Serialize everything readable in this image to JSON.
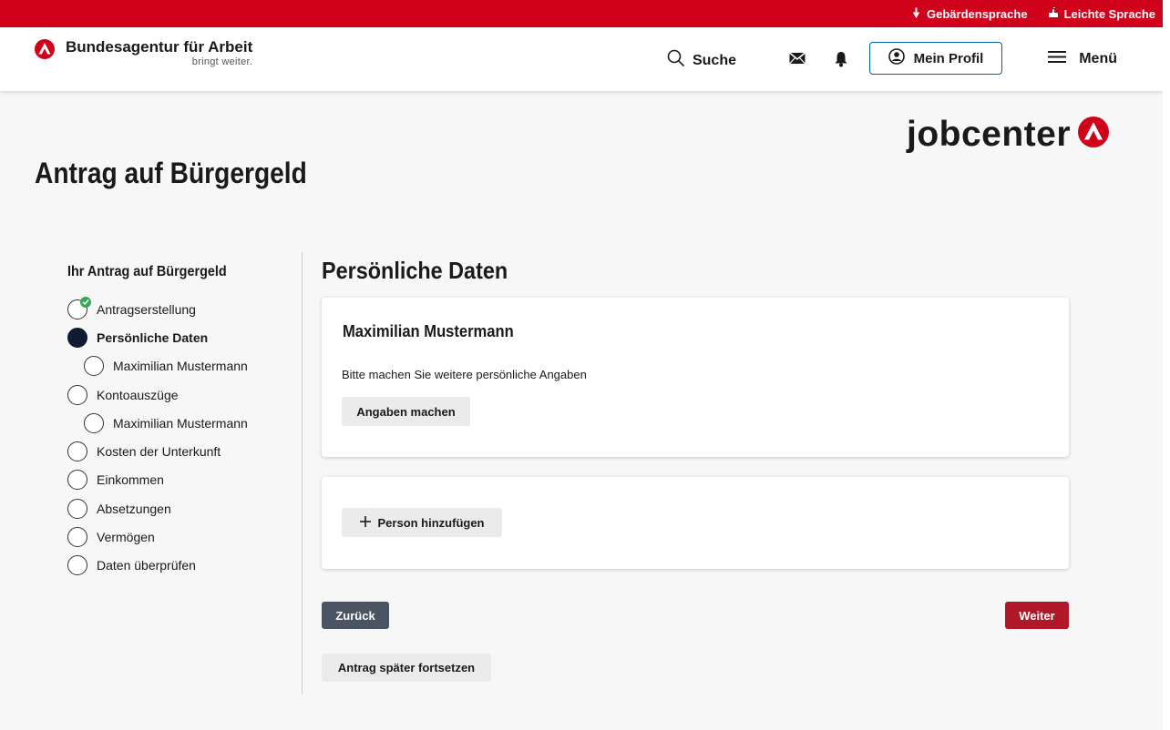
{
  "topbar": {
    "sign_language": "Gebärdensprache",
    "easy_language": "Leichte Sprache",
    "sign_icon": "hand-sign-icon",
    "easy_icon": "hand-easy-icon"
  },
  "header": {
    "brand_name": "Bundesagentur für Arbeit",
    "brand_tagline": "bringt weiter.",
    "search_label": "Suche",
    "profile_label": "Mein Profil",
    "menu_label": "Menü"
  },
  "page": {
    "title": "Antrag auf Bürgergeld",
    "jobcenter_logo": "jobcenter"
  },
  "sidebar": {
    "title": "Ihr Antrag auf Bürgergeld",
    "steps": [
      {
        "label": "Antragserstellung",
        "state": "done"
      },
      {
        "label": "Persönliche Daten",
        "state": "current"
      },
      {
        "label": "Maximilian Mustermann",
        "state": "open",
        "sub": true
      },
      {
        "label": "Kontoauszüge",
        "state": "open"
      },
      {
        "label": "Maximilian Mustermann",
        "state": "open",
        "sub": true
      },
      {
        "label": "Kosten der Unterkunft",
        "state": "open"
      },
      {
        "label": "Einkommen",
        "state": "open"
      },
      {
        "label": "Absetzungen",
        "state": "open"
      },
      {
        "label": "Vermögen",
        "state": "open"
      },
      {
        "label": "Daten überprüfen",
        "state": "open"
      }
    ]
  },
  "main": {
    "section_title": "Persönliche Daten",
    "person_card": {
      "name": "Maximilian Mustermann",
      "hint": "Bitte machen Sie weitere persönliche Angaben",
      "button": "Angaben machen"
    },
    "add_person_button": "Person hinzufügen",
    "back_button": "Zurück",
    "next_button": "Weiter",
    "later_button": "Antrag später fortsetzen"
  },
  "colors": {
    "brand_red": "#d0021b",
    "next_red": "#b0182a",
    "back_grey": "#4a5462",
    "profile_border": "#0062a3",
    "done_green": "#35a853",
    "current_navy": "#101b33"
  }
}
